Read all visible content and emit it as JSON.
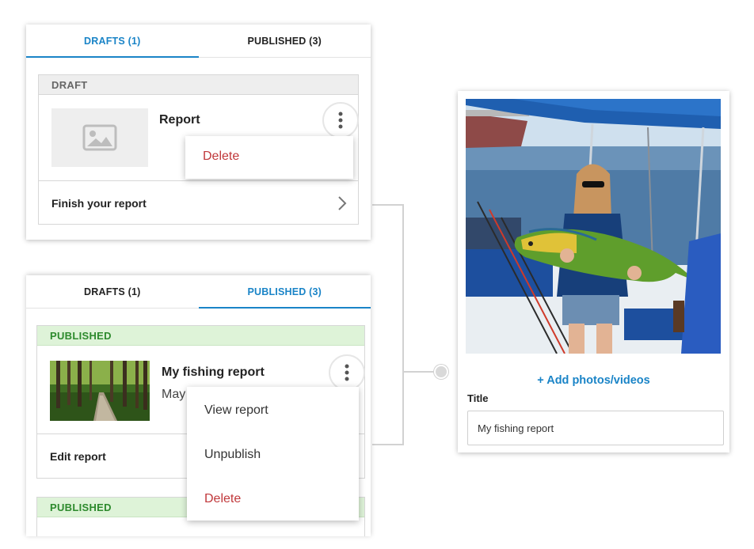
{
  "draft_panel": {
    "tabs": [
      {
        "label": "DRAFTS (1)",
        "active": true
      },
      {
        "label": "PUBLISHED (3)",
        "active": false
      }
    ],
    "card": {
      "status": "DRAFT",
      "title": "Report",
      "menu": [
        {
          "label": "Delete",
          "style": "danger"
        }
      ],
      "action_label": "Finish your report"
    }
  },
  "published_panel": {
    "tabs": [
      {
        "label": "DRAFTS (1)",
        "active": false
      },
      {
        "label": "PUBLISHED (3)",
        "active": true
      }
    ],
    "cards": [
      {
        "status": "PUBLISHED",
        "title": "My fishing report",
        "subtitle": "May",
        "action_label": "Edit report"
      },
      {
        "status": "PUBLISHED"
      }
    ],
    "menu": [
      {
        "label": "View report",
        "style": "normal"
      },
      {
        "label": "Unpublish",
        "style": "normal"
      },
      {
        "label": "Delete",
        "style": "danger"
      }
    ]
  },
  "editor_panel": {
    "add_media_label": "+ Add photos/videos",
    "title_label": "Title",
    "title_value": "My fishing report"
  },
  "colors": {
    "accent": "#1a84c7",
    "danger": "#c0383b",
    "published_green": "#2d8a2d",
    "published_bg": "#def3d8",
    "draft_bg": "#eeeeee"
  }
}
